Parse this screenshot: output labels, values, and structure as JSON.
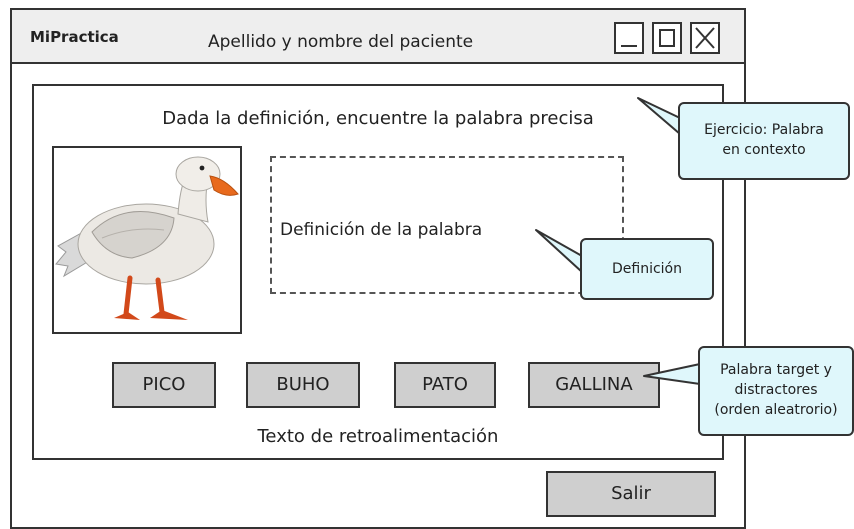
{
  "window": {
    "app_name": "MiPractica",
    "title": "Apellido y nombre del paciente"
  },
  "exercise": {
    "instruction": "Dada la definición, encuentre la palabra precisa",
    "image_alt": "Pato",
    "definition_placeholder": "Definición de la palabra",
    "options": [
      "PICO",
      "BUHO",
      "PATO",
      "GALLINA"
    ],
    "feedback": "Texto de retroalimentación"
  },
  "footer": {
    "exit_label": "Salir"
  },
  "annotations": {
    "exercise_type": [
      "Ejercicio: Palabra",
      "en contexto"
    ],
    "definition": "Definición",
    "options": [
      "Palabra target y",
      "distractores",
      "(orden aleatrorio)"
    ]
  },
  "colors": {
    "callout_fill": "#dff7fb",
    "button_fill": "#cfcfcf",
    "titlebar_fill": "#eeeeee",
    "duck_bill": "#e86a1d"
  }
}
